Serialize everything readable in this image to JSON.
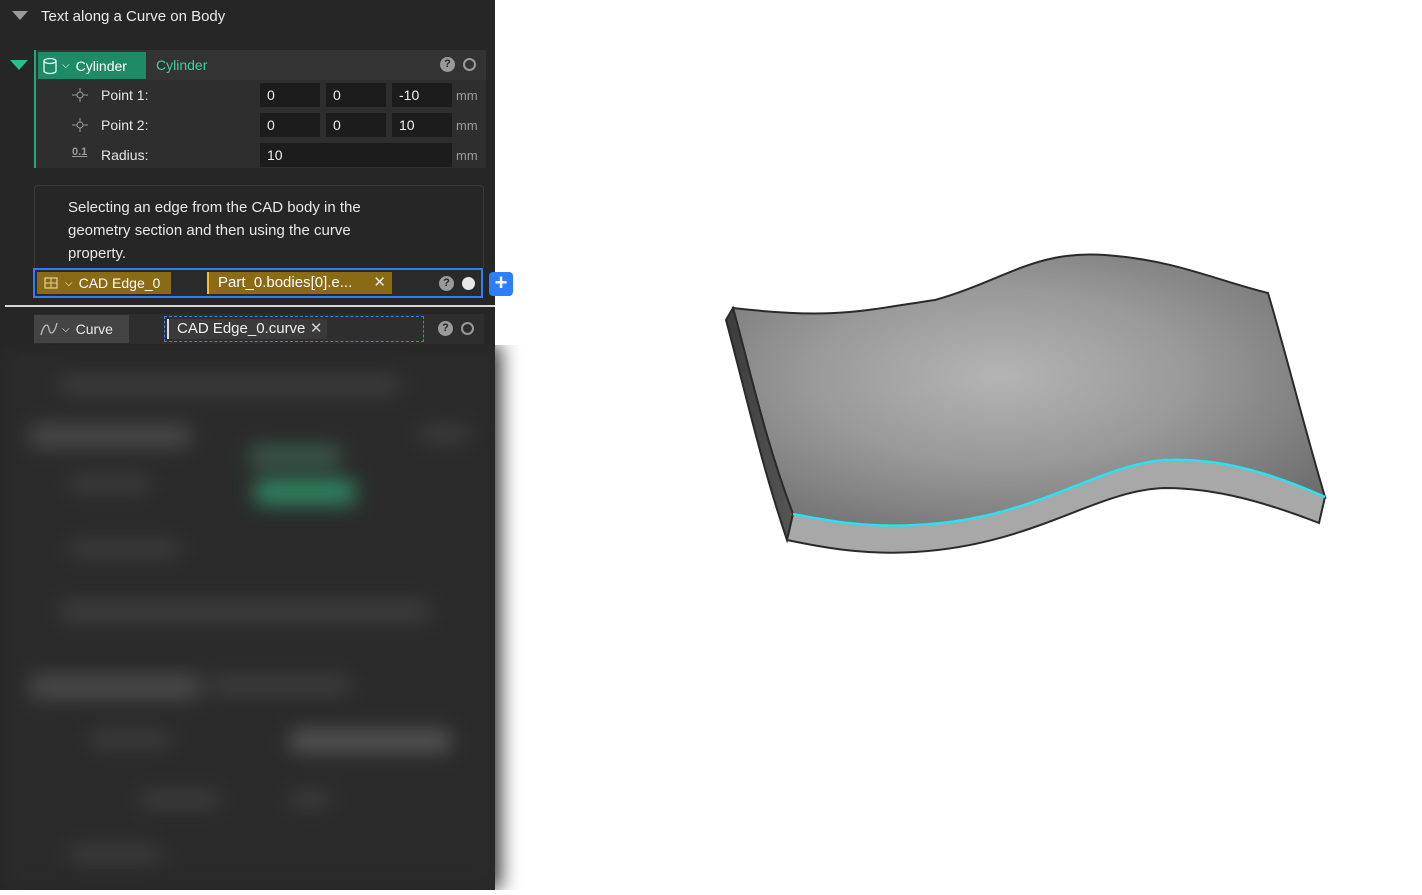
{
  "panel": {
    "title": "Text along a Curve on Body",
    "cylinder": {
      "chip_label": "Cylinder",
      "name": "Cylinder",
      "point1": {
        "label": "Point 1:",
        "x": "0",
        "y": "0",
        "z": "-10",
        "unit": "mm"
      },
      "point2": {
        "label": "Point 2:",
        "x": "0",
        "y": "0",
        "z": "10",
        "unit": "mm"
      },
      "radius": {
        "label": "Radius:",
        "value": "10",
        "unit": "mm",
        "icon_text": "0.1"
      }
    },
    "description": "Selecting an edge from the CAD body in the geometry section and then using the curve property.",
    "cad_edge": {
      "chip_label": "CAD Edge_0",
      "value": "Part_0.bodies[0].e..."
    },
    "curve": {
      "chip_label": "Curve",
      "value": "CAD Edge_0.curve"
    }
  },
  "colors": {
    "panel_bg": "#262626",
    "cylinder_accent": "#1f8a66",
    "cad_edge_accent": "#8a6a14",
    "selection_blue": "#2d7ff9",
    "edge_highlight": "#29e3f0"
  }
}
